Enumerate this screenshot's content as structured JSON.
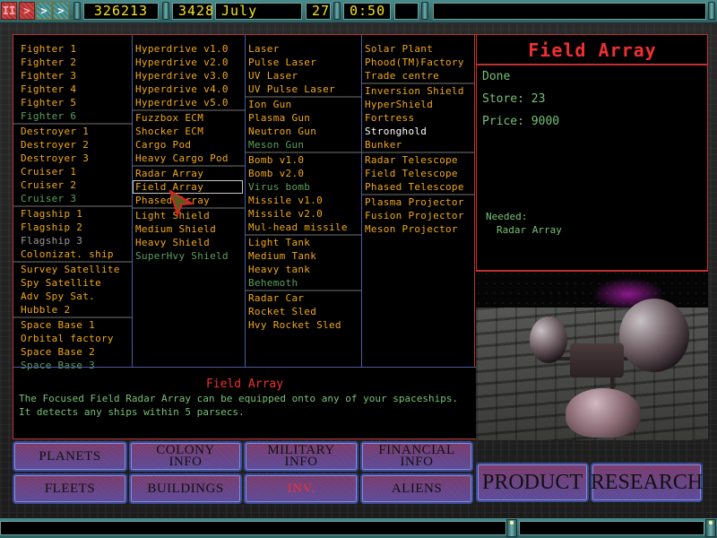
{
  "topbar": {
    "pause_label": "II",
    "play_label": ">",
    "fast_label": ">",
    "faster_label": ">",
    "credits": "326213",
    "year": "3428",
    "month": "July",
    "day": "27",
    "time": "0:50",
    "message": ""
  },
  "columns": [
    {
      "groups": [
        [
          {
            "label": "Fighter 1",
            "state": "available"
          },
          {
            "label": "Fighter 2",
            "state": "available"
          },
          {
            "label": "Fighter 3",
            "state": "available"
          },
          {
            "label": "Fighter 4",
            "state": "available"
          },
          {
            "label": "Fighter 5",
            "state": "available"
          },
          {
            "label": "Fighter 6",
            "state": "researchable"
          }
        ],
        [
          {
            "label": "Destroyer 1",
            "state": "available"
          },
          {
            "label": "Destroyer 2",
            "state": "available"
          },
          {
            "label": "Destroyer 3",
            "state": "available"
          },
          {
            "label": "Cruiser 1",
            "state": "available"
          },
          {
            "label": "Cruiser 2",
            "state": "available"
          },
          {
            "label": "Cruiser 3",
            "state": "researchable"
          }
        ],
        [
          {
            "label": "Flagship 1",
            "state": "available"
          },
          {
            "label": "Flagship 2",
            "state": "available"
          },
          {
            "label": "Flagship 3",
            "state": "unavailable"
          },
          {
            "label": "Colonizat. ship",
            "state": "available"
          }
        ],
        [
          {
            "label": "Survey Satellite",
            "state": "available"
          },
          {
            "label": "Spy Satellite",
            "state": "available"
          },
          {
            "label": "Adv Spy Sat.",
            "state": "available"
          },
          {
            "label": "Hubble 2",
            "state": "available"
          }
        ],
        [
          {
            "label": "Space Base 1",
            "state": "available"
          },
          {
            "label": "Orbital factory",
            "state": "available"
          },
          {
            "label": "Space Base 2",
            "state": "available"
          },
          {
            "label": "Space Base 3",
            "state": "researchable"
          }
        ]
      ]
    },
    {
      "groups": [
        [
          {
            "label": "Hyperdrive v1.0",
            "state": "available"
          },
          {
            "label": "Hyperdrive v2.0",
            "state": "available"
          },
          {
            "label": "Hyperdrive v3.0",
            "state": "available"
          },
          {
            "label": "Hyperdrive v4.0",
            "state": "available"
          },
          {
            "label": "Hyperdrive v5.0",
            "state": "available"
          }
        ],
        [
          {
            "label": "Fuzzbox ECM",
            "state": "available"
          },
          {
            "label": "Shocker ECM",
            "state": "available"
          },
          {
            "label": "Cargo Pod",
            "state": "available"
          },
          {
            "label": "Heavy Cargo Pod",
            "state": "available"
          }
        ],
        [
          {
            "label": "Radar Array",
            "state": "available"
          },
          {
            "label": "Field Array",
            "state": "available",
            "selected": true
          },
          {
            "label": "Phased Array",
            "state": "available"
          }
        ],
        [
          {
            "label": "Light Shield",
            "state": "available"
          },
          {
            "label": "Medium Shield",
            "state": "available"
          },
          {
            "label": "Heavy Shield",
            "state": "available"
          },
          {
            "label": "SuperHvy Shield",
            "state": "researchable"
          }
        ]
      ]
    },
    {
      "groups": [
        [
          {
            "label": "Laser",
            "state": "available"
          },
          {
            "label": "Pulse Laser",
            "state": "available"
          },
          {
            "label": "UV Laser",
            "state": "available"
          },
          {
            "label": "UV Pulse Laser",
            "state": "available"
          }
        ],
        [
          {
            "label": "Ion Gun",
            "state": "available"
          },
          {
            "label": "Plasma Gun",
            "state": "available"
          },
          {
            "label": "Neutron Gun",
            "state": "available"
          },
          {
            "label": "Meson Gun",
            "state": "researchable"
          }
        ],
        [
          {
            "label": "Bomb v1.0",
            "state": "available"
          },
          {
            "label": "Bomb v2.0",
            "state": "available"
          },
          {
            "label": "Virus bomb",
            "state": "researchable"
          },
          {
            "label": "Missile v1.0",
            "state": "available"
          },
          {
            "label": "Missile v2.0",
            "state": "available"
          },
          {
            "label": "Mul-head missile",
            "state": "available"
          }
        ],
        [
          {
            "label": "Light Tank",
            "state": "available"
          },
          {
            "label": "Medium Tank",
            "state": "available"
          },
          {
            "label": "Heavy tank",
            "state": "available"
          },
          {
            "label": "Behemoth",
            "state": "researchable"
          }
        ],
        [
          {
            "label": "Radar Car",
            "state": "available"
          },
          {
            "label": "Rocket Sled",
            "state": "available"
          },
          {
            "label": "Hvy Rocket Sled",
            "state": "available"
          }
        ]
      ]
    },
    {
      "groups": [
        [
          {
            "label": "Solar Plant",
            "state": "available"
          },
          {
            "label": "Phood(TM)Factory",
            "state": "available"
          },
          {
            "label": "Trade centre",
            "state": "available"
          }
        ],
        [
          {
            "label": "Inversion Shield",
            "state": "available"
          },
          {
            "label": "HyperShield",
            "state": "available"
          },
          {
            "label": "Fortress",
            "state": "available"
          },
          {
            "label": "Stronghold",
            "state": "highlight"
          },
          {
            "label": "Bunker",
            "state": "available"
          }
        ],
        [
          {
            "label": "Radar Telescope",
            "state": "available"
          },
          {
            "label": "Field Telescope",
            "state": "available"
          },
          {
            "label": "Phased Telescope",
            "state": "available"
          }
        ],
        [
          {
            "label": "Plasma Projector",
            "state": "available"
          },
          {
            "label": "Fusion Projector",
            "state": "available"
          },
          {
            "label": "Meson Projector",
            "state": "available"
          }
        ]
      ]
    }
  ],
  "detail": {
    "title": "Field Array",
    "status": "Done",
    "store_label": "Store: 23",
    "price_label": "Price: 9000",
    "needed_label": "Needed:",
    "needed_items": [
      "Radar Array"
    ]
  },
  "description": {
    "title": "Field Array",
    "text": "The Focused Field Radar Array can be equipped onto any of your spaceships. It detects any ships within 5 parsecs."
  },
  "nav": {
    "planets": "PLANETS",
    "colony_info": "COLONY INFO",
    "military_info": "MILITARY INFO",
    "financial_info": "FINANCIAL INFO",
    "fleets": "FLEETS",
    "buildings": "BUILDINGS",
    "inv": "INV.",
    "aliens": "ALIENS",
    "product": "PRODUCT",
    "research": "RESEARCH"
  },
  "colors": {
    "available": "#f0a818",
    "researchable": "#5aa060",
    "unavailable": "#9a9a9a",
    "highlight": "#ffffff",
    "title_red": "#f03030",
    "info_green": "#78c078",
    "lcd_yellow": "#f4e020"
  },
  "icons": {
    "pause": "pause-icon",
    "play": "play-icon",
    "fast": "fast-forward-icon",
    "faster": "fastest-forward-icon",
    "cursor": "mouse-pointer-icon"
  }
}
